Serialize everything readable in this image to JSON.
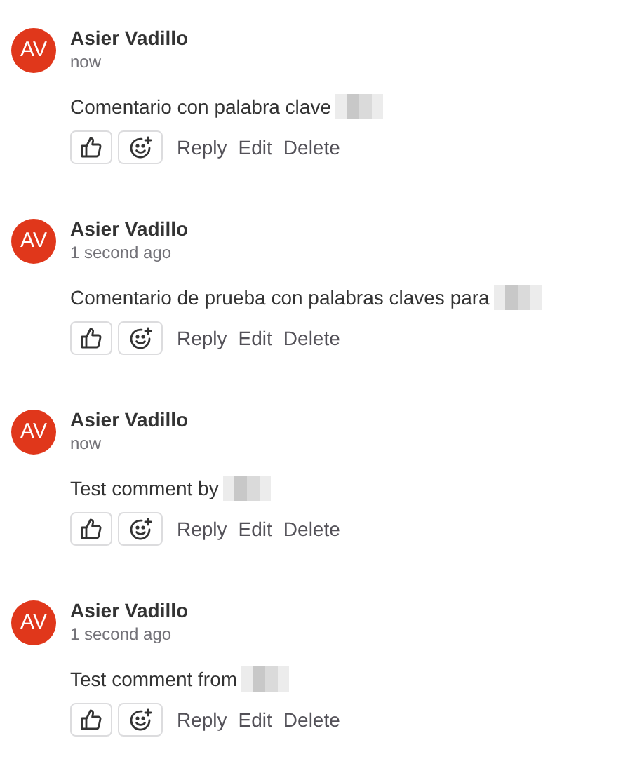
{
  "comments": [
    {
      "initials": "AV",
      "author": "Asier Vadillo",
      "time": "now",
      "body": "Comentario con palabra clave",
      "redacted": true,
      "actions": [
        "Reply",
        "Edit",
        "Delete"
      ]
    },
    {
      "initials": "AV",
      "author": "Asier Vadillo",
      "time": "1 second ago",
      "body": "Comentario de prueba con palabras claves para",
      "redacted": true,
      "actions": [
        "Reply",
        "Edit",
        "Delete"
      ]
    },
    {
      "initials": "AV",
      "author": "Asier Vadillo",
      "time": "now",
      "body": "Test comment by",
      "redacted": true,
      "actions": [
        "Reply",
        "Edit",
        "Delete"
      ]
    },
    {
      "initials": "AV",
      "author": "Asier Vadillo",
      "time": "1 second ago",
      "body": "Test comment from",
      "redacted": true,
      "actions": [
        "Reply",
        "Edit",
        "Delete"
      ]
    }
  ]
}
